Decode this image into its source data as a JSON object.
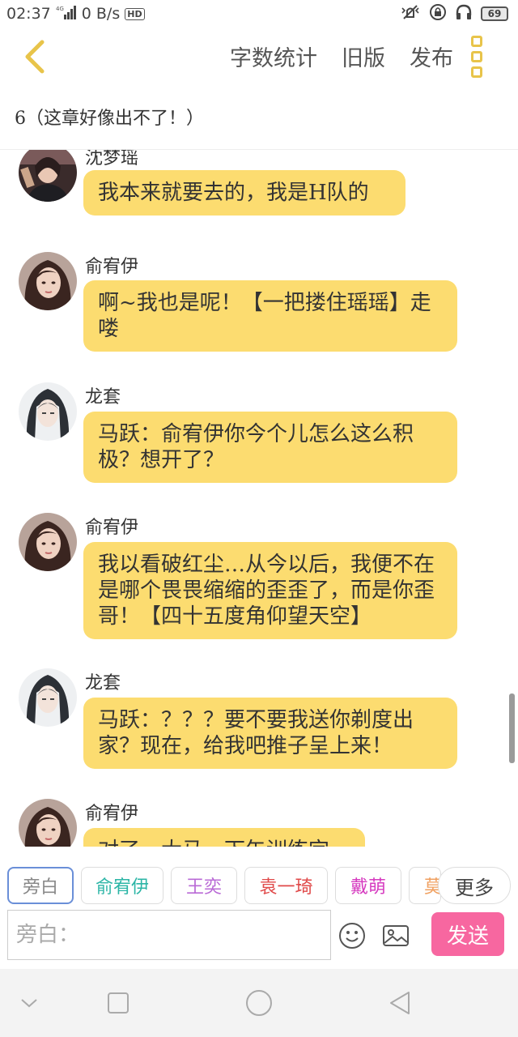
{
  "status_bar": {
    "time": "02:37",
    "net_speed": "0 B/s",
    "hd_badge": "HD",
    "battery": "69"
  },
  "topbar": {
    "word_count": "字数统计",
    "old_version": "旧版",
    "publish": "发布"
  },
  "chapter": {
    "title": "6（这章好像出不了！）"
  },
  "messages": [
    {
      "speaker": "沈梦瑶",
      "text": "我本来就要去的，我是H队的"
    },
    {
      "speaker": "俞宥伊",
      "text": "啊~我也是呢！【一把搂住瑶瑶】走喽"
    },
    {
      "speaker": "龙套",
      "text": "马跃：俞宥伊你今个儿怎么这么积极？想开了？"
    },
    {
      "speaker": "俞宥伊",
      "text": "我以看破红尘…从今以后，我便不在是哪个畏畏缩缩的歪歪了，而是你歪哥！【四十五度角仰望天空】"
    },
    {
      "speaker": "龙套",
      "text": "马跃：？？？要不要我送你剃度出家？现在，给我吧推子呈上来！"
    },
    {
      "speaker": "俞宥伊",
      "text": "对了，大马，下午训练完"
    }
  ],
  "character_tabs": [
    {
      "label": "旁白",
      "color": "#888888"
    },
    {
      "label": "俞宥伊",
      "color": "#2bb5a6"
    },
    {
      "label": "王奕",
      "color": "#b96ad6"
    },
    {
      "label": "袁一琦",
      "color": "#e04a4a"
    },
    {
      "label": "戴萌",
      "color": "#d63cc0"
    },
    {
      "label": "莫",
      "color": "#f0a060"
    }
  ],
  "more_label": "更多",
  "input": {
    "placeholder": "旁白："
  },
  "send_label": "发送",
  "colors": {
    "accent_yellow": "#e8c44a",
    "bubble": "#fcdc70",
    "send_button": "#f767a0",
    "active_tab_border": "#6a8fd8"
  }
}
